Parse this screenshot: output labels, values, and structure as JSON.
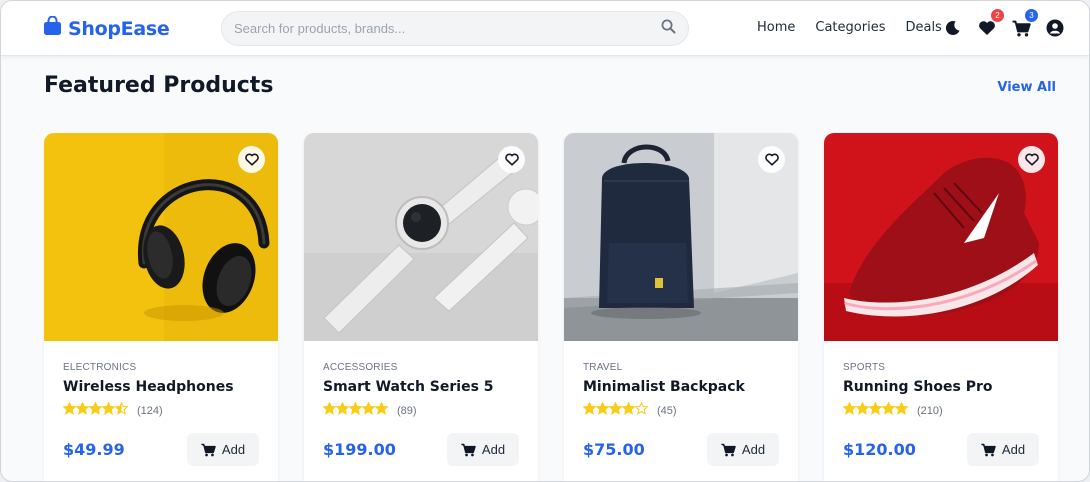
{
  "brand": {
    "name": "ShopEase",
    "color": "#2563eb",
    "icon": "shopping-bag-icon"
  },
  "search": {
    "placeholder": "Search for products, brands...",
    "value": "",
    "icon": "search-icon"
  },
  "nav": {
    "home": "Home",
    "categories": "Categories",
    "deals": "Deals"
  },
  "header_icons": {
    "theme": "moon-icon",
    "wishlist": {
      "icon": "heart-icon",
      "badge": "2",
      "badge_color": "#ef4444"
    },
    "cart": {
      "icon": "cart-icon",
      "badge": "3",
      "badge_color": "#2563eb"
    },
    "account": "user-circle-icon"
  },
  "section": {
    "title": "Featured Products",
    "view_all": "View All"
  },
  "products": [
    {
      "category": "ELECTRONICS",
      "name": "Wireless Headphones",
      "rating": 4.5,
      "reviews": "(124)",
      "price": "$49.99",
      "add_label": "Add"
    },
    {
      "category": "ACCESSORIES",
      "name": "Smart Watch Series 5",
      "rating": 5,
      "reviews": "(89)",
      "price": "$199.00",
      "add_label": "Add"
    },
    {
      "category": "TRAVEL",
      "name": "Minimalist Backpack",
      "rating": 4,
      "reviews": "(45)",
      "price": "$75.00",
      "add_label": "Add"
    },
    {
      "category": "SPORTS",
      "name": "Running Shoes Pro",
      "rating": 5,
      "reviews": "(210)",
      "price": "$120.00",
      "add_label": "Add"
    }
  ],
  "colors": {
    "star": "#facc15",
    "price": "#2563eb"
  }
}
